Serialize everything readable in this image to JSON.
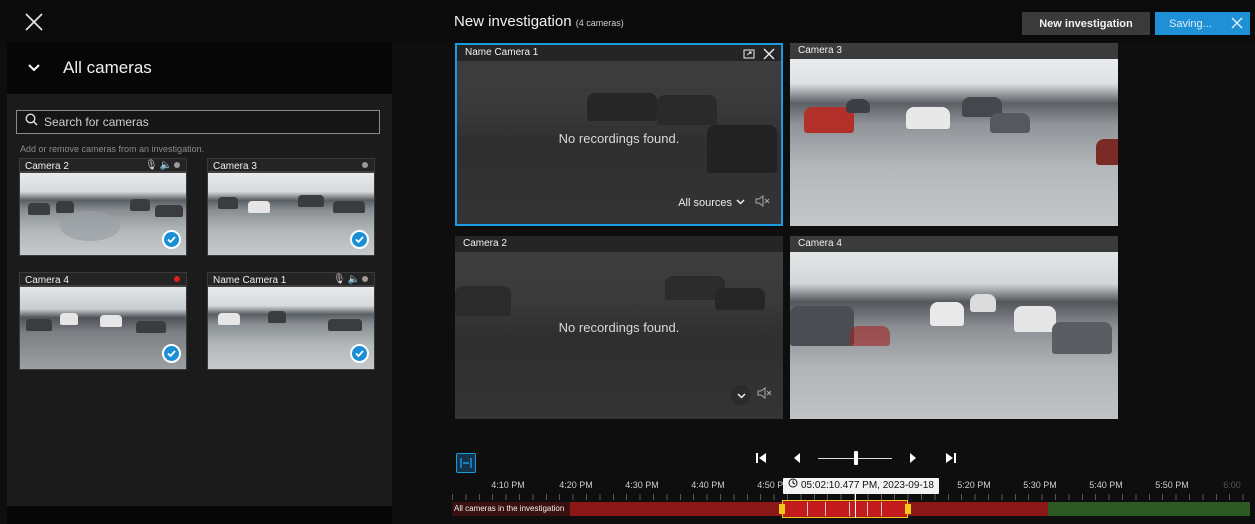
{
  "header": {
    "investigation_title": "New investigation",
    "camera_count": "(4 cameras)",
    "new_investigation_label": "New investigation",
    "saving_label": "Saving..."
  },
  "left_panel": {
    "section_title": "All cameras",
    "search_placeholder": "Search for cameras",
    "hint": "Add or remove cameras from an investigation.",
    "cameras": [
      {
        "name": "Camera 2",
        "selected": true
      },
      {
        "name": "Camera 3",
        "selected": true
      },
      {
        "name": "Camera 4",
        "selected": true
      },
      {
        "name": "Name Camera 1",
        "selected": true
      }
    ]
  },
  "grid": {
    "tiles": [
      {
        "name": "Name Camera 1",
        "status": "No recordings found.",
        "sources_label": "All sources"
      },
      {
        "name": "Camera 3",
        "status": ""
      },
      {
        "name": "Camera 2",
        "status": "No recordings found."
      },
      {
        "name": "Camera 4",
        "status": ""
      }
    ]
  },
  "timeline": {
    "ticks": [
      "4:10 PM",
      "4:20 PM",
      "4:30 PM",
      "4:40 PM",
      "4:50 PM",
      "5:20 PM",
      "5:30 PM",
      "5:40 PM",
      "5:50 PM",
      "6:00"
    ],
    "current_time": "05:02:10.477 PM, 2023-09-18",
    "track_label": "All cameras in the investigation"
  },
  "colors": {
    "accent": "#1a9ae0",
    "recording_red": "#8b1717",
    "recording_green": "#2d5a24",
    "selection_yellow": "#f0c81a"
  },
  "icons": [
    "close-icon",
    "chevron-down-icon",
    "search-icon",
    "microphone-icon",
    "speaker-icon",
    "check-icon",
    "fullscreen-icon",
    "mute-icon",
    "skip-start-icon",
    "step-back-icon",
    "step-forward-icon",
    "skip-end-icon",
    "clock-icon"
  ]
}
